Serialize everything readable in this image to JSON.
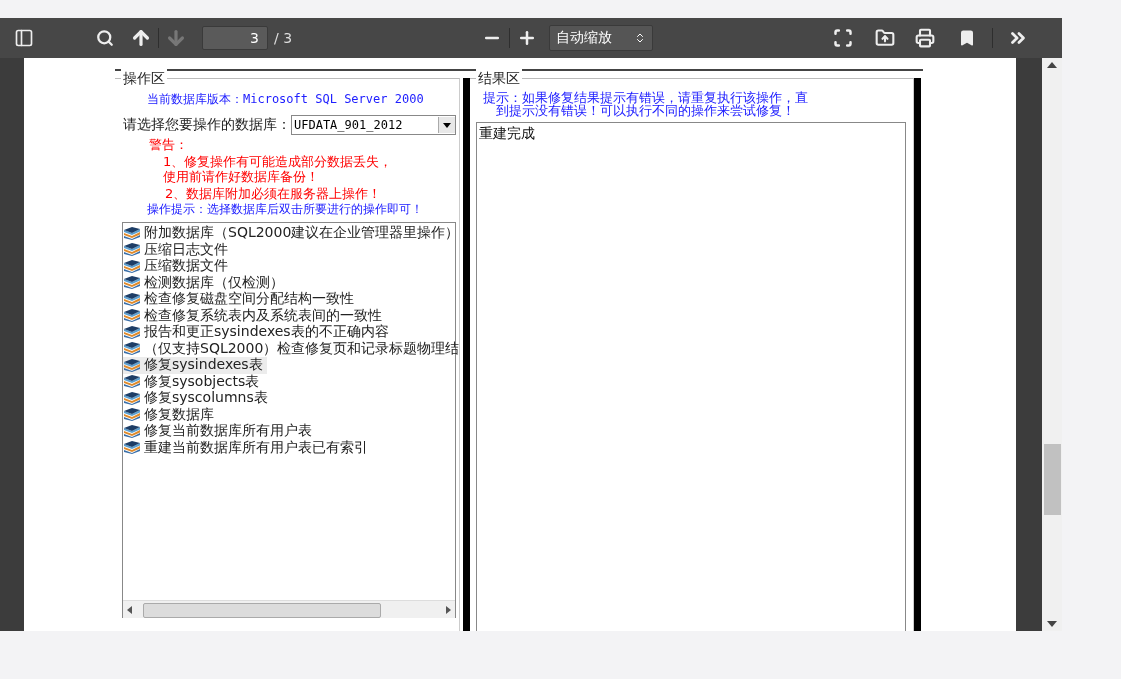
{
  "toolbar": {
    "page_number": "3",
    "page_count": "/ 3",
    "zoom_select": "自动缩放",
    "prev_page": {
      "disabled": false
    },
    "next_page": {
      "disabled": true
    }
  },
  "operation_panel": {
    "legend": "操作区",
    "version_text": "当前数据库版本：Microsoft SQL Server  2000",
    "db_label": "请选择您要操作的数据库：",
    "db_value": "UFDATA_901_2012",
    "warning_title": "警告：",
    "warnings": [
      "1、修复操作有可能造成部分数据丢失，使用前请作好数据库备份！",
      "2、数据库附加必须在服务器上操作！"
    ],
    "hint": "操作提示：选择数据库后双击所要进行的操作即可！",
    "operations": [
      {
        "label": "附加数据库（SQL2000建议在企业管理器里操作）",
        "selected": false
      },
      {
        "label": "压缩日志文件",
        "selected": false
      },
      {
        "label": "压缩数据文件",
        "selected": false
      },
      {
        "label": "检测数据库（仅检测）",
        "selected": false
      },
      {
        "label": "检查修复磁盘空间分配结构一致性",
        "selected": false
      },
      {
        "label": "检查修复系统表内及系统表间的一致性",
        "selected": false
      },
      {
        "label": "报告和更正sysindexes表的不正确内容",
        "selected": false
      },
      {
        "label": "（仅支持SQL2000）检查修复页和记录标题物理结",
        "selected": false
      },
      {
        "label": "修复sysindexes表",
        "selected": true
      },
      {
        "label": "修复sysobjects表",
        "selected": false
      },
      {
        "label": "修复syscolumns表",
        "selected": false
      },
      {
        "label": "修复数据库",
        "selected": false
      },
      {
        "label": "修复当前数据库所有用户表",
        "selected": false
      },
      {
        "label": "重建当前数据库所有用户表已有索引",
        "selected": false
      }
    ]
  },
  "result_panel": {
    "legend": "结果区",
    "hint": "提示：如果修复结果提示有错误，请重复执行该操作，直到提示没有错误！可以执行不同的操作来尝试修复！",
    "output": "重建完成"
  }
}
